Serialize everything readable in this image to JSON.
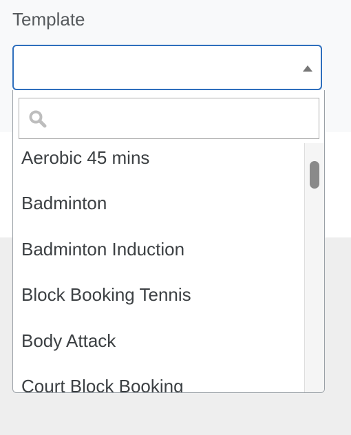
{
  "field": {
    "label": "Template",
    "selected_value": ""
  },
  "dropdown": {
    "search_placeholder": "",
    "options": [
      "Aerobic 45 mins",
      "Badminton",
      "Badminton Induction",
      "Block Booking Tennis",
      "Body Attack",
      "Court Block Booking"
    ]
  },
  "icons": {
    "search": "search-icon",
    "caret": "caret-up-icon"
  }
}
